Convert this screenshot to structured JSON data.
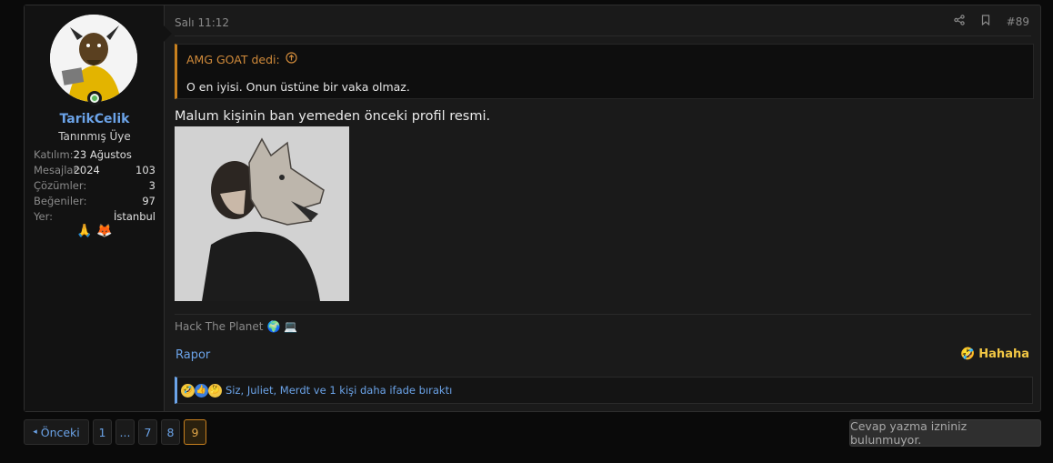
{
  "user": {
    "username": "TarikCelik",
    "title": "Tanınmış Üye",
    "stats": [
      {
        "label": "Katılım:",
        "value": "23 Ağustos 2024"
      },
      {
        "label": "Mesajlar:",
        "value": "103"
      },
      {
        "label": "Çözümler:",
        "value": "3"
      },
      {
        "label": "Beğeniler:",
        "value": "97"
      },
      {
        "label": "Yer:",
        "value": "İstanbul"
      }
    ],
    "badges": [
      "🙏",
      "🦊"
    ]
  },
  "post": {
    "time": "Salı 11:12",
    "number": "#89",
    "quote": {
      "author": "AMG GOAT dedi:",
      "text": "O en iyisi. Onun üstüne bir vaka olmaz."
    },
    "message": "Malum kişinin ban yemeden önceki profil resmi.",
    "signature": "Hack The Planet",
    "signature_emoji": "🌍 💻",
    "report_label": "Rapor",
    "reaction_label": "Hahaha",
    "reactions_summary": "Siz, Juliet, Merdt ve 1 kişi daha ifade bıraktı"
  },
  "pagination": {
    "prev": "Önceki",
    "pages": [
      "1",
      "...",
      "7",
      "8",
      "9"
    ],
    "current": "9"
  },
  "no_reply": "Cevap yazma izniniz bulunmuyor."
}
